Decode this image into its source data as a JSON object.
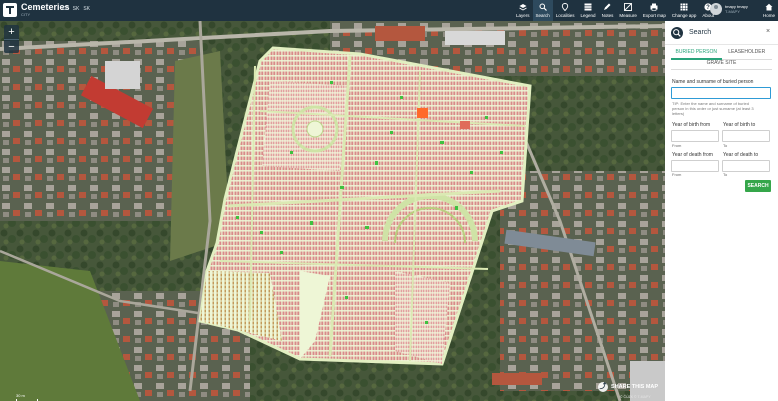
{
  "header": {
    "title": "Cemeteries",
    "subtitle": "CITY",
    "languages": [
      "CZ",
      "SK",
      "SK"
    ],
    "tools": [
      {
        "label": "Layers",
        "icon": "layers-icon"
      },
      {
        "label": "Search",
        "icon": "search-icon",
        "active": true
      },
      {
        "label": "Localities",
        "icon": "localities-icon"
      },
      {
        "label": "Legend",
        "icon": "legend-icon"
      },
      {
        "label": "Notes",
        "icon": "notes-icon"
      },
      {
        "label": "Measure",
        "icon": "measure-icon"
      },
      {
        "label": "Export map",
        "icon": "export-map-icon"
      },
      {
        "label": "Change app",
        "icon": "change-app-icon"
      },
      {
        "label": "About",
        "icon": "about-icon"
      }
    ],
    "user": {
      "name": "tmapy tmapy",
      "role": "T-MAPY"
    },
    "home_label": "Home"
  },
  "map": {
    "zoom_in": "+",
    "zoom_out": "−",
    "share_label": "SHARE THIS MAP",
    "scale_label": "30 m",
    "copyright": "© ČÚZK © T-MAPY"
  },
  "panel": {
    "title": "Search",
    "close": "×",
    "tabs": [
      "BURIED PERSON",
      "LEASEHOLDER"
    ],
    "tab_row2": "GRAVE SITE",
    "name_label": "Name and surname of buried person",
    "name_value": "",
    "tip": "TIP: Enter the name and surname of buried person in this order or just surname (at least 3 letters)",
    "birth_from_label": "Year of birth from",
    "birth_to_label": "Year of birth to",
    "death_from_label": "Year of death from",
    "death_to_label": "Year of death to",
    "from_hint": "From",
    "to_hint": "To",
    "search_button": "SEARCH"
  },
  "colors": {
    "topbar": "#1f3240",
    "accent": "#28a37a",
    "search_button": "#35a64a",
    "cemetery_fill": "#e9f3c9",
    "grave_red": "#d98a8a",
    "grave_green": "#3fc13f"
  }
}
